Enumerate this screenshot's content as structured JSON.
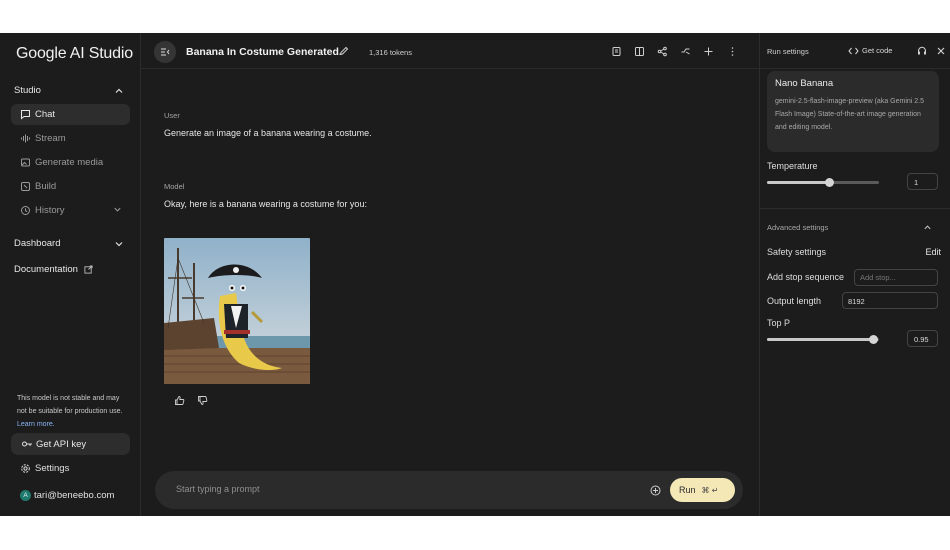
{
  "sidebar": {
    "logo": "Google AI Studio",
    "studio_label": "Studio",
    "items": [
      {
        "label": "Chat",
        "icon": "chat-icon"
      },
      {
        "label": "Stream",
        "icon": "waveform-icon"
      },
      {
        "label": "Generate media",
        "icon": "media-icon"
      },
      {
        "label": "Build",
        "icon": "build-icon"
      },
      {
        "label": "History",
        "icon": "history-icon"
      }
    ],
    "dashboard_label": "Dashboard",
    "documentation_label": "Documentation",
    "notice_text": "This model is not stable and may not be suitable for production use.",
    "notice_link": "Learn more.",
    "api_key_label": "Get API key",
    "settings_label": "Settings",
    "avatar_letter": "A",
    "account_email": "tari@beneebo.com"
  },
  "topbar": {
    "title": "Banana In Costume Generated.",
    "tokens": "1,316 tokens"
  },
  "chat": {
    "user_label": "User",
    "user_message": "Generate an image of a banana wearing a costume.",
    "model_label": "Model",
    "model_message": "Okay, here is a banana wearing a costume for you:"
  },
  "prompt": {
    "placeholder": "Start typing a prompt",
    "run_label": "Run",
    "run_shortcut": "⌘ ↵"
  },
  "panel": {
    "title": "Run settings",
    "get_code_label": "Get code",
    "model_name": "Nano Banana",
    "model_description": "gemini-2.5-flash-image-preview (aka Gemini 2.5 Flash Image) State-of-the-art image generation and editing model.",
    "temperature_label": "Temperature",
    "temperature_value": "1",
    "temperature_fraction": 0.55,
    "advanced_label": "Advanced settings",
    "safety_label": "Safety settings",
    "safety_edit": "Edit",
    "stop_label": "Add stop sequence",
    "stop_placeholder": "Add stop...",
    "output_label": "Output length",
    "output_value": "8192",
    "topp_label": "Top P",
    "topp_value": "0.95",
    "topp_fraction": 0.95
  },
  "colors": {
    "background": "#1c1c1c",
    "run_button": "#f5e8b7",
    "link": "#8ab4f8"
  }
}
